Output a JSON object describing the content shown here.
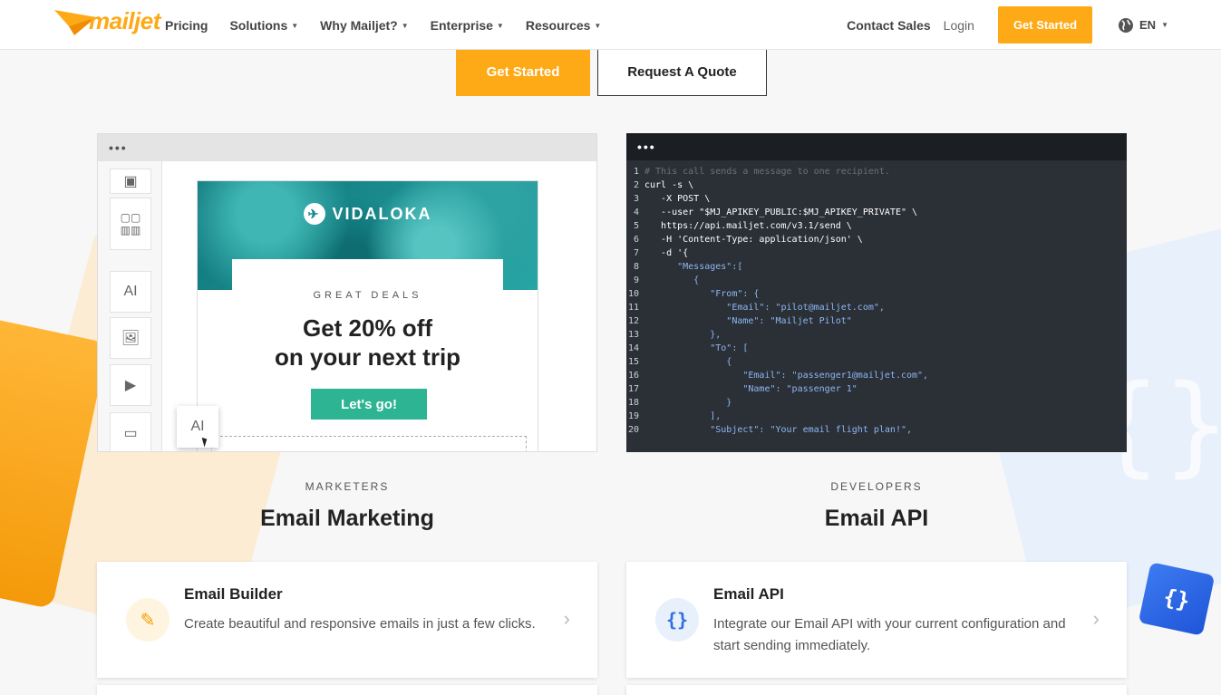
{
  "header": {
    "logo_text": "mailjet",
    "nav": [
      {
        "label": "Pricing",
        "has_caret": false
      },
      {
        "label": "Solutions",
        "has_caret": true
      },
      {
        "label": "Why Mailjet?",
        "has_caret": true
      },
      {
        "label": "Enterprise",
        "has_caret": true
      },
      {
        "label": "Resources",
        "has_caret": true
      }
    ],
    "contact_sales": "Contact Sales",
    "login": "Login",
    "get_started": "Get Started",
    "language": "EN",
    "brand_color": "#fea916"
  },
  "hero": {
    "get_started": "Get Started",
    "request_quote": "Request A Quote"
  },
  "editor_mock": {
    "dots": "•••",
    "brand_name": "VIDALOKA",
    "eyebrow": "GREAT DEALS",
    "headline_line1": "Get 20% off",
    "headline_line2": "on your next trip",
    "cta": "Let's go!",
    "tool_text_glyph": "AI",
    "accent": "#2cb493"
  },
  "code_mock": {
    "dots": "•••",
    "lines": [
      {
        "n": "1",
        "text": "# This call sends a message to one recipient.",
        "kind": "c"
      },
      {
        "n": "2",
        "text": "curl -s \\",
        "kind": "p"
      },
      {
        "n": "3",
        "text": "   -X POST \\",
        "kind": "p"
      },
      {
        "n": "4",
        "text": "   --user \"$MJ_APIKEY_PUBLIC:$MJ_APIKEY_PRIVATE\" \\",
        "kind": "p"
      },
      {
        "n": "5",
        "text": "   https://api.mailjet.com/v3.1/send \\",
        "kind": "p"
      },
      {
        "n": "6",
        "text": "   -H 'Content-Type: application/json' \\",
        "kind": "p"
      },
      {
        "n": "7",
        "text": "   -d '{",
        "kind": "p"
      },
      {
        "n": "8",
        "text": "      \"Messages\":[",
        "kind": "s"
      },
      {
        "n": "9",
        "text": "         {",
        "kind": "s"
      },
      {
        "n": "10",
        "text": "            \"From\": {",
        "kind": "s"
      },
      {
        "n": "11",
        "text": "               \"Email\": \"pilot@mailjet.com\",",
        "kind": "s"
      },
      {
        "n": "12",
        "text": "               \"Name\": \"Mailjet Pilot\"",
        "kind": "s"
      },
      {
        "n": "13",
        "text": "            },",
        "kind": "s"
      },
      {
        "n": "14",
        "text": "            \"To\": [",
        "kind": "s"
      },
      {
        "n": "15",
        "text": "               {",
        "kind": "s"
      },
      {
        "n": "16",
        "text": "                  \"Email\": \"passenger1@mailjet.com\",",
        "kind": "s"
      },
      {
        "n": "17",
        "text": "                  \"Name\": \"passenger 1\"",
        "kind": "s"
      },
      {
        "n": "18",
        "text": "               }",
        "kind": "s"
      },
      {
        "n": "19",
        "text": "            ],",
        "kind": "s"
      },
      {
        "n": "20",
        "text": "            \"Subject\": \"Your email flight plan!\",",
        "kind": "s"
      }
    ]
  },
  "sections": {
    "marketers": {
      "kicker": "MARKETERS",
      "title": "Email Marketing"
    },
    "developers": {
      "kicker": "DEVELOPERS",
      "title": "Email API"
    }
  },
  "cards": {
    "builder": {
      "icon": "pencil-icon",
      "title": "Email Builder",
      "description": "Create beautiful and responsive emails in just a few clicks."
    },
    "api": {
      "icon": "braces-icon",
      "title": "Email API",
      "description": "Integrate our Email API with your current configuration and start sending immediately."
    }
  }
}
